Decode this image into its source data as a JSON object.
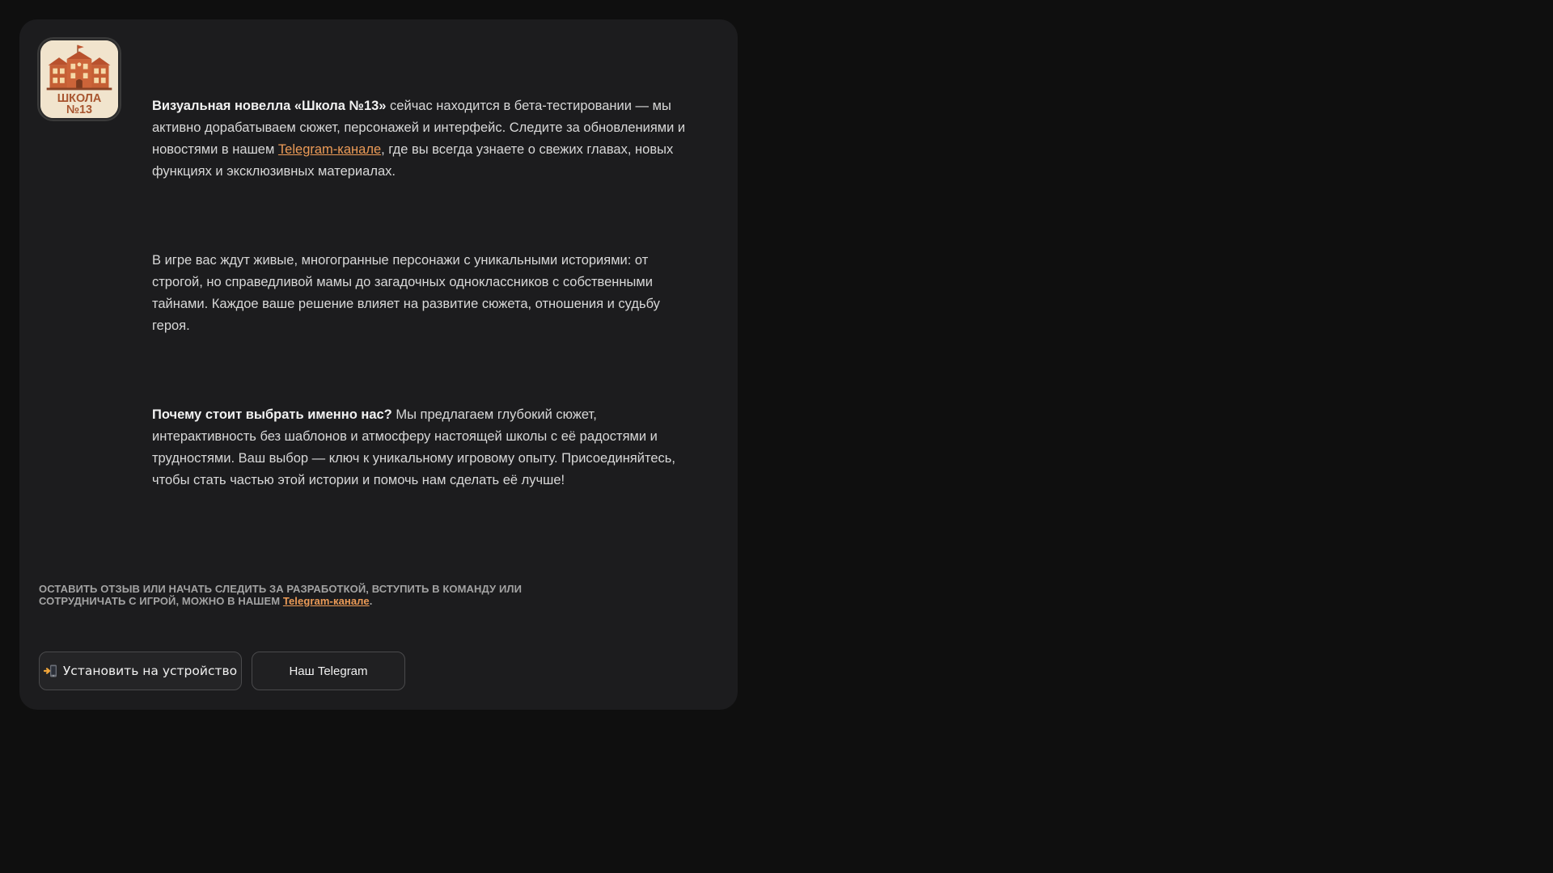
{
  "logo": {
    "alt": "Школа №13",
    "line1": "ШКОЛА",
    "line2": "№13"
  },
  "intro": {
    "bold": "Визуальная новелла «Школа №13»",
    "text_before_link": " сейчас находится в бета-тестировании — мы активно дорабатываем сюжет, персонажей и интерфейс. Следите за обновлениями и новостями в нашем ",
    "link": "Telegram-канале",
    "text_after_link": ", где вы всегда узнаете о свежих главах, новых функциях и эксклюзивных материалах."
  },
  "characters": {
    "text": "В игре вас ждут живые, многогранные персонажи с уникальными историями: от строгой, но справедливой мамы до загадочных одноклассников с собственными тайнами. Каждое ваше решение влияет на развитие сюжета, отношения и судьбу героя."
  },
  "why": {
    "bold": "Почему стоит выбрать именно нас?",
    "text": " Мы предлагаем глубокий сюжет, интерактивность без шаблонов и атмосферу настоящей школы с её радостями и трудностями. Ваш выбор — ключ к уникальному игровому опыту. Присоединяйтесь, чтобы стать частью этой истории и помочь нам сделать её лучше!"
  },
  "cta": {
    "text": "Оставить отзыв или начать следить за разработкой, вступить в команду или сотрудничать с игрой, можно в нашем ",
    "link": "Telegram-канале",
    "end": "."
  },
  "buttons": {
    "install": "Установить на устройство",
    "install_icon": "phone-install-icon",
    "telegram": "Наш Telegram"
  },
  "colors": {
    "background": "#0f0f0f",
    "card": "#1c1c1e",
    "accent_link": "#ec9b57",
    "text": "#d8d8d8"
  }
}
